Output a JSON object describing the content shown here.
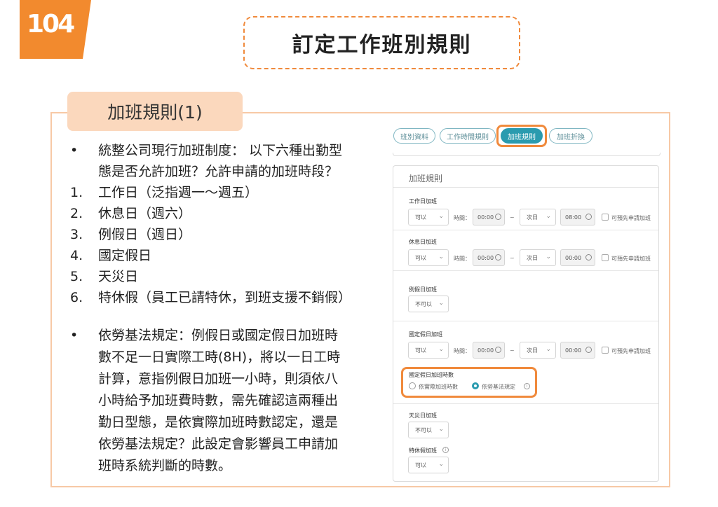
{
  "logo": {
    "text": "104",
    "color": "#f28a2e"
  },
  "title": "訂定工作班別規則",
  "section_tab": "加班規則(1)",
  "left": {
    "bullet1_marker": "•",
    "bullet1_lines": [
      "統整公司現行加班制度： 以下六種出勤型",
      "態是否允許加班？允許申請的加班時段？"
    ],
    "numbered": [
      {
        "n": "1.",
        "t": "工作日（泛指週一～週五）"
      },
      {
        "n": "2.",
        "t": "休息日（週六）"
      },
      {
        "n": "3.",
        "t": "例假日（週日）"
      },
      {
        "n": "4.",
        "t": "國定假日"
      },
      {
        "n": "5.",
        "t": "天災日"
      },
      {
        "n": "6.",
        "t": "特休假（員工已請特休，到班支援不銷假）"
      }
    ],
    "bullet2_marker": "•",
    "bullet2_lines": [
      "依勞基法規定：例假日或國定假日加班時",
      "數不足一日實際工時(8H)，將以一日工時",
      "計算，意指例假日加班一小時，則須依八",
      "小時給予加班費時數，需先確認這兩種出",
      "勤日型態，是依實際加班時數認定，還是",
      "依勞基法規定？此設定會影響員工申請加",
      "班時系統判斷的時數。"
    ]
  },
  "panel": {
    "tabs": [
      "班別資料",
      "工作時間規則",
      "加班規則",
      "加班折換"
    ],
    "active_tab": "加班規則",
    "card_title": "加班規則",
    "workday": {
      "label": "工作日加班",
      "select": "可以",
      "time_label": "時間：",
      "start": "00:00",
      "tilde": "~",
      "next_day": "次日",
      "end": "08:00",
      "checkbox": "可預先申請加班"
    },
    "restday": {
      "label": "休息日加班",
      "select": "可以",
      "time_label": "時間：",
      "start": "00:00",
      "tilde": "~",
      "next_day": "次日",
      "end": "00:00",
      "checkbox": "可預先申請加班"
    },
    "regular_holiday": {
      "label": "例假日加班",
      "select": "不可以"
    },
    "national_holiday": {
      "label": "國定假日加班",
      "select": "可以",
      "time_label": "時間：",
      "start": "00:00",
      "tilde": "~",
      "next_day": "次日",
      "end": "00:00",
      "checkbox": "可預先申請加班"
    },
    "holiday_hours": {
      "label": "國定假日加班時數",
      "option1": "依實際加班時數",
      "option2": "依勞基法規定",
      "selected": "依勞基法規定"
    },
    "disaster": {
      "label": "天災日加班",
      "select": "不可以"
    },
    "special_leave": {
      "label": "特休假加班",
      "select": "可以"
    },
    "chevron": "⌄",
    "info": "i"
  },
  "colors": {
    "accent": "#f08a3c",
    "teal": "#2a9baf",
    "tab_bg": "#fbd8bd",
    "frame": "#f7c9a6"
  }
}
